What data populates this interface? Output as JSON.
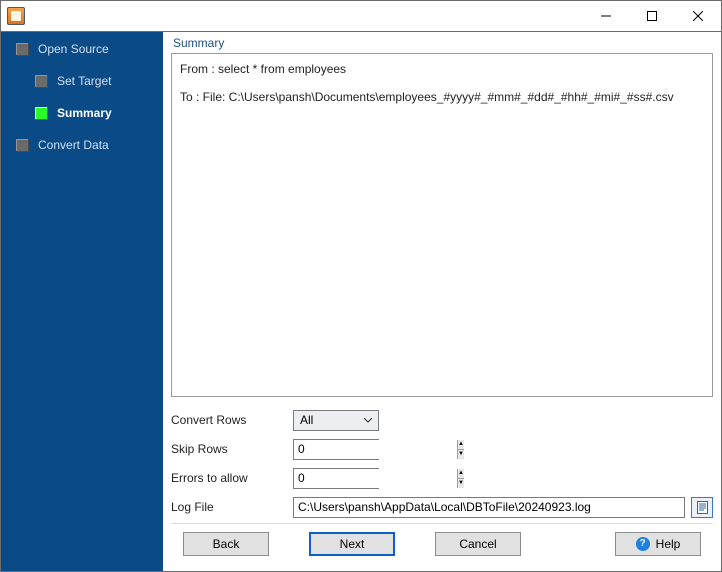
{
  "window": {
    "title": ""
  },
  "sidebar": {
    "steps": [
      {
        "label": "Open Source",
        "active": false,
        "sub": false
      },
      {
        "label": "Set Target",
        "active": false,
        "sub": true
      },
      {
        "label": "Summary",
        "active": true,
        "sub": true
      },
      {
        "label": "Convert Data",
        "active": false,
        "sub": false
      }
    ]
  },
  "summary": {
    "title": "Summary",
    "from": "From : select * from employees",
    "to": "To : File: C:\\Users\\pansh\\Documents\\employees_#yyyy#_#mm#_#dd#_#hh#_#mi#_#ss#.csv"
  },
  "form": {
    "convert_rows_label": "Convert Rows",
    "convert_rows_value": "All",
    "skip_rows_label": "Skip Rows",
    "skip_rows_value": "0",
    "errors_label": "Errors to allow",
    "errors_value": "0",
    "logfile_label": "Log File",
    "logfile_value": "C:\\Users\\pansh\\AppData\\Local\\DBToFile\\20240923.log"
  },
  "footer": {
    "back": "Back",
    "next": "Next",
    "cancel": "Cancel",
    "help": "Help"
  }
}
